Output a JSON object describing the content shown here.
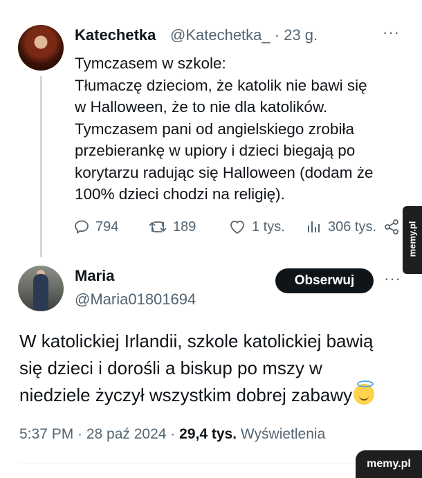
{
  "tweet1": {
    "author_name": "Katechetka",
    "handle": "@Katechetka_",
    "time": "· 23 g.",
    "more": "···",
    "lines": [
      "Tymczasem w szkole:",
      "Tłumaczę dzieciom, że katolik nie bawi się",
      "w Halloween, że to nie dla katolików.",
      "Tymczasem pani od angielskiego zrobiła",
      "przebierankę w upiory i dzieci biegają po",
      "korytarzu radując się Halloween (dodam że",
      "100% dzieci chodzi na religię)."
    ],
    "replies": "794",
    "retweets": "189",
    "likes": "1 tys.",
    "views": "306 tys."
  },
  "tweet2": {
    "author_name": "Maria",
    "handle": "@Maria01801694",
    "follow_label": "Obserwuj",
    "more": "···",
    "lines": [
      "W katolickiej Irlandii, szkole katolickiej bawią",
      "się dzieci i dorośli a biskup po mszy w",
      "niedziele życzył wszystkim dobrej zabawy"
    ],
    "time": "5:37 PM · 28 paź 2024 ·",
    "views_count": "29,4 tys.",
    "views_label": "Wyświetlenia"
  },
  "watermark": {
    "side": "memy.pl",
    "bottom": "memy.pl"
  },
  "icons": [
    "reply-icon",
    "retweet-icon",
    "like-icon",
    "views-icon",
    "share-icon",
    "halo-smile-emoji"
  ]
}
